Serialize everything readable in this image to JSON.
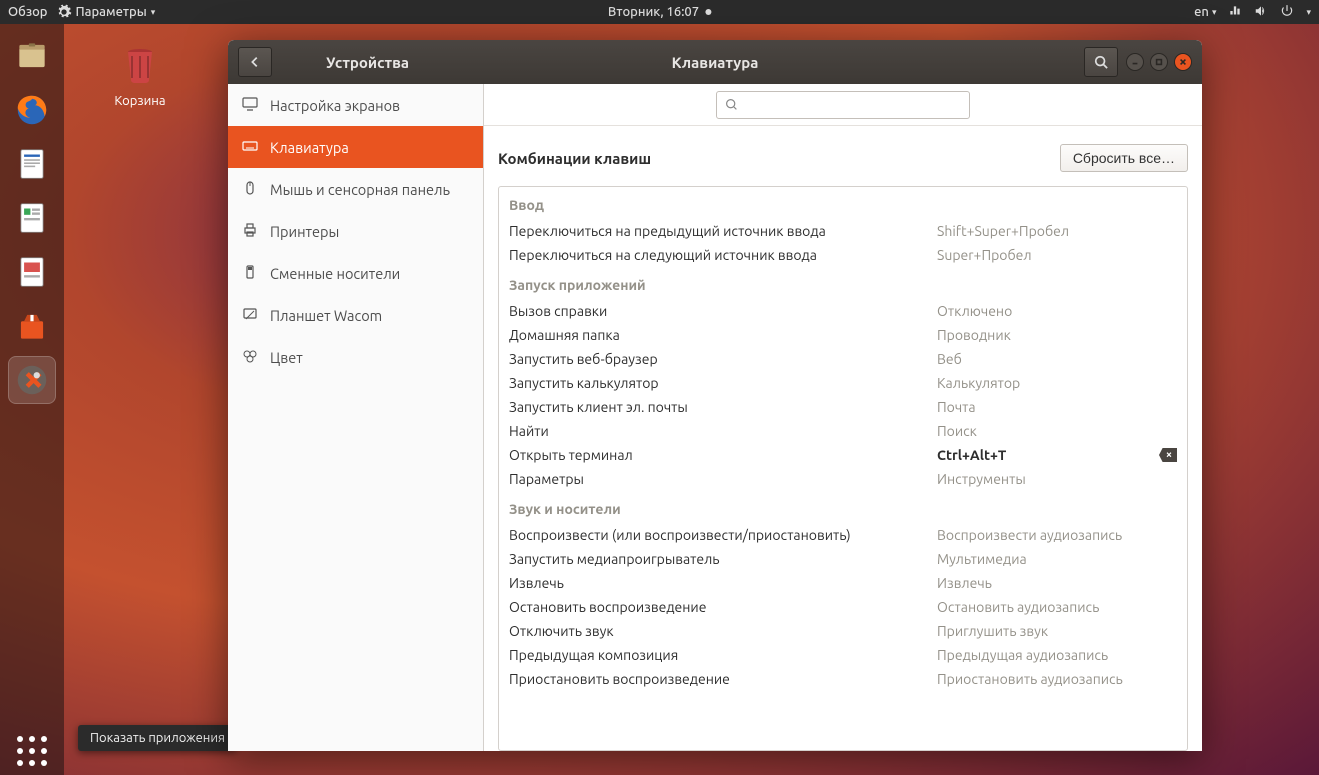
{
  "top_panel": {
    "activities": "Обзор",
    "app_menu": "Параметры",
    "clock": "Вторник, 16:07",
    "lang": "en"
  },
  "desktop": {
    "trash_label": "Корзина"
  },
  "tooltip": {
    "show_apps": "Показать приложения"
  },
  "window": {
    "back_section": "Устройства",
    "title": "Клавиатура",
    "sidebar": [
      {
        "id": "displays",
        "label": "Настройка экранов"
      },
      {
        "id": "keyboard",
        "label": "Клавиатура"
      },
      {
        "id": "mouse",
        "label": "Мышь и сенсорная панель"
      },
      {
        "id": "printers",
        "label": "Принтеры"
      },
      {
        "id": "removable",
        "label": "Сменные носители"
      },
      {
        "id": "wacom",
        "label": "Планшет Wacom"
      },
      {
        "id": "color",
        "label": "Цвет"
      }
    ],
    "section_header": "Комбинации клавиш",
    "reset_all": "Сбросить все…",
    "groups": [
      {
        "title": "Ввод",
        "items": [
          {
            "label": "Переключиться на предыдущий источник ввода",
            "value": "Shift+Super+Пробел"
          },
          {
            "label": "Переключиться на следующий источник ввода",
            "value": "Super+Пробел"
          }
        ]
      },
      {
        "title": "Запуск приложений",
        "items": [
          {
            "label": "Вызов справки",
            "value": "Отключено"
          },
          {
            "label": "Домашняя папка",
            "value": "Проводник"
          },
          {
            "label": "Запустить веб-браузер",
            "value": "Веб"
          },
          {
            "label": "Запустить калькулятор",
            "value": "Калькулятор"
          },
          {
            "label": "Запустить клиент эл. почты",
            "value": "Почта"
          },
          {
            "label": "Найти",
            "value": "Поиск"
          },
          {
            "label": "Открыть терминал",
            "value": "Ctrl+Alt+T",
            "highlighted": true,
            "erasable": true
          },
          {
            "label": "Параметры",
            "value": "Инструменты"
          }
        ]
      },
      {
        "title": "Звук и носители",
        "items": [
          {
            "label": "Воспроизвести (или воспроизвести/приостановить)",
            "value": "Воспроизвести аудиозапись"
          },
          {
            "label": "Запустить медиапроигрыватель",
            "value": "Мультимедиа"
          },
          {
            "label": "Извлечь",
            "value": "Извлечь"
          },
          {
            "label": "Остановить воспроизведение",
            "value": "Остановить аудиозапись"
          },
          {
            "label": "Отключить звук",
            "value": "Приглушить звук"
          },
          {
            "label": "Предыдущая композиция",
            "value": "Предыдущая аудиозапись"
          },
          {
            "label": "Приостановить воспроизведение",
            "value": "Приостановить аудиозапись"
          }
        ]
      }
    ]
  }
}
